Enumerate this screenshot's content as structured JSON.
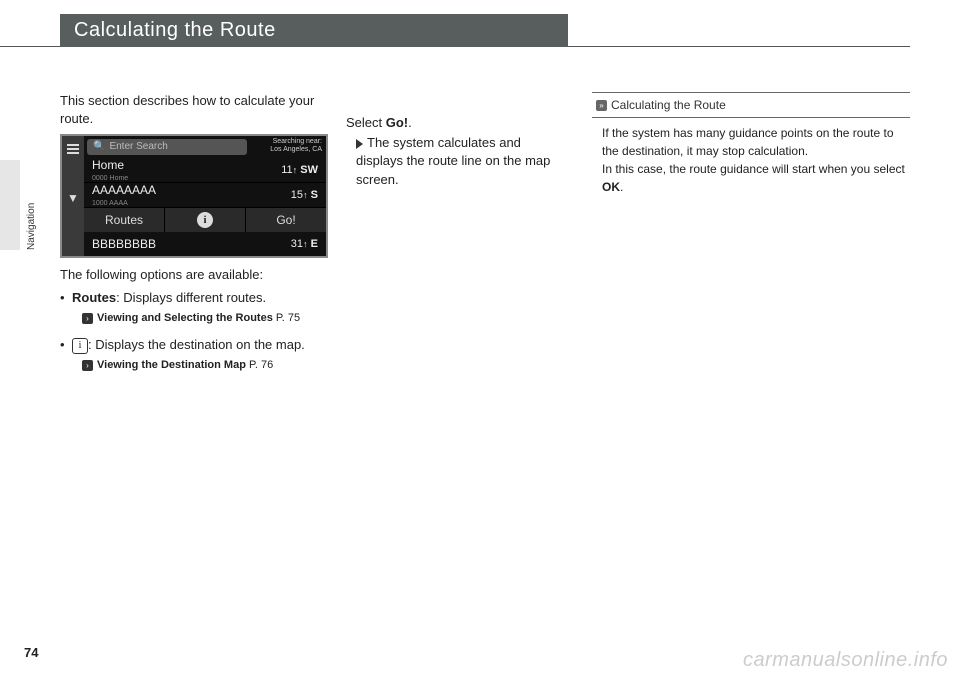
{
  "page": {
    "title": "Calculating the Route",
    "section_label": "Navigation",
    "number": "74",
    "watermark": "carmanualsonline.info"
  },
  "left": {
    "intro": "This section describes how to calculate your route.",
    "options_intro": "The following options are available:",
    "routes_bullet_bold": "Routes",
    "routes_bullet_rest": ": Displays different routes.",
    "routes_xref_bold": "Viewing and Selecting the Routes",
    "routes_xref_page": " P. 75",
    "info_bullet_rest": ": Displays the destination on the map.",
    "info_xref_bold": "Viewing the Destination Map",
    "info_xref_page": " P. 76"
  },
  "device": {
    "search_placeholder": "Enter Search",
    "near_label": "Searching near:",
    "near_value": "Los Angeles, CA",
    "rows": [
      {
        "name": "Home",
        "sub": "0000 Home",
        "dist": "11",
        "unit": "SW"
      },
      {
        "name": "AAAAAAAA",
        "sub": "1000 AAAA",
        "dist": "15",
        "unit": "S"
      },
      {
        "name": "BBBBBBBB",
        "sub": "",
        "dist": "31",
        "unit": "E"
      }
    ],
    "routes_label": "Routes",
    "go_label": "Go!"
  },
  "mid": {
    "select_prefix": "Select ",
    "select_bold": "Go!",
    "select_suffix": ".",
    "result": "The system calculates and displays the route line on the map screen."
  },
  "right": {
    "header": "Calculating the Route",
    "body1": "If the system has many guidance points on the route to the destination, it may stop calculation.",
    "body2a": "In this case, the route guidance will start when you select ",
    "body2b": "OK",
    "body2c": "."
  }
}
